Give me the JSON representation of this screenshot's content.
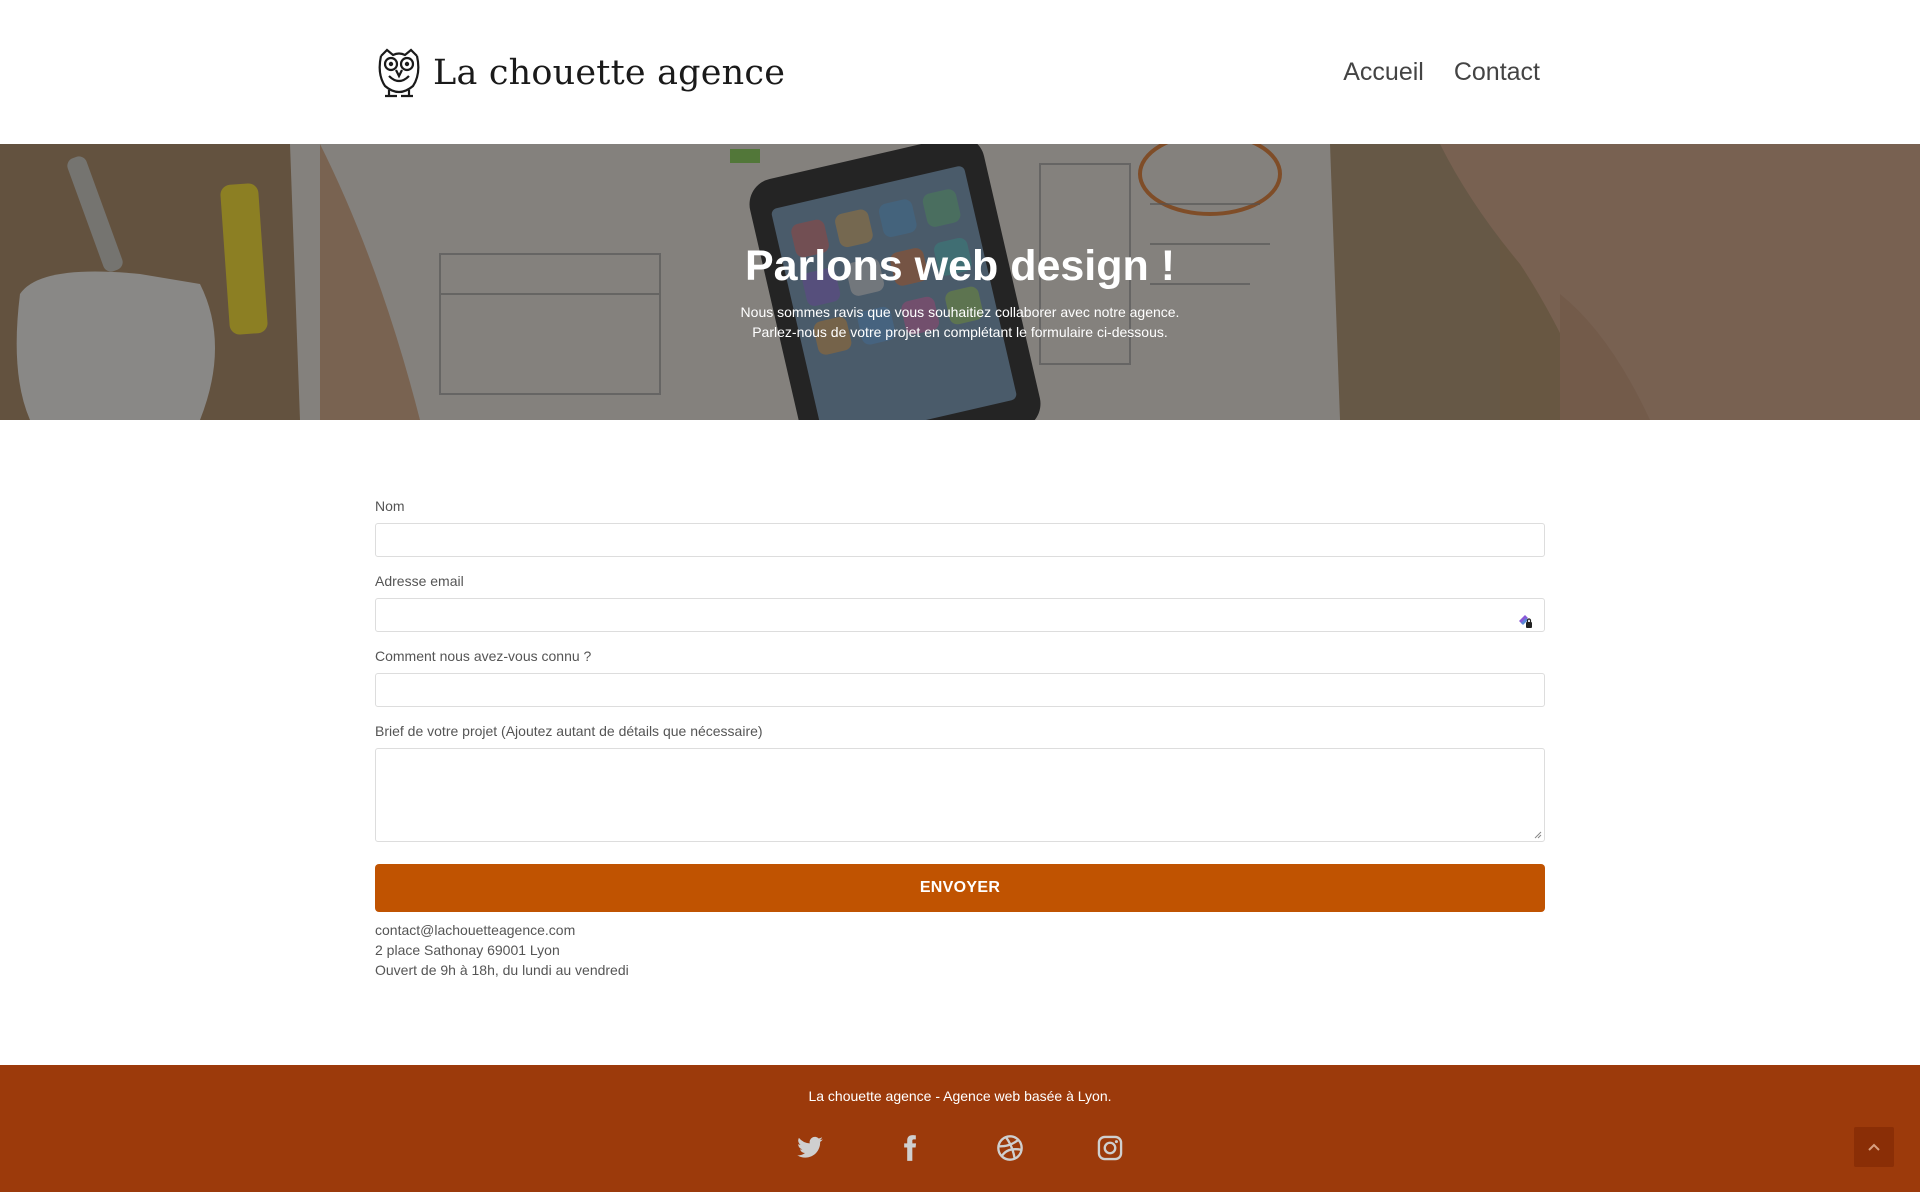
{
  "header": {
    "brand": "La chouette agence",
    "nav": [
      {
        "label": "Accueil"
      },
      {
        "label": "Contact"
      }
    ]
  },
  "hero": {
    "title": "Parlons web design !",
    "subtitle_line1": "Nous sommes ravis que vous souhaitiez collaborer avec notre agence.",
    "subtitle_line2": "Parlez-nous de votre projet en complétant le formulaire ci-dessous."
  },
  "form": {
    "name_label": "Nom",
    "name_value": "",
    "email_label": "Adresse email",
    "email_value": "",
    "source_label": "Comment nous avez-vous connu ?",
    "source_value": "",
    "brief_label": "Brief de votre projet (Ajoutez autant de détails que nécessaire)",
    "brief_value": "",
    "submit_label": "ENVOYER"
  },
  "contact": {
    "email": "contact@lachouetteagence.com",
    "address": "2 place Sathonay 69001 Lyon",
    "hours": "Ouvert de 9h à 18h, du lundi au vendredi"
  },
  "footer": {
    "tagline": "La chouette agence - Agence web basée à Lyon.",
    "socials": [
      "twitter-icon",
      "facebook-icon",
      "dribbble-icon",
      "instagram-icon"
    ]
  },
  "colors": {
    "accent": "#c05301",
    "footer_bg": "#9c3a0b",
    "to_top_bg": "#8a2e06"
  },
  "icons": {
    "logo": "owl-icon",
    "password_manager": "password-manager-icon",
    "back_to_top": "chevron-up-icon"
  }
}
